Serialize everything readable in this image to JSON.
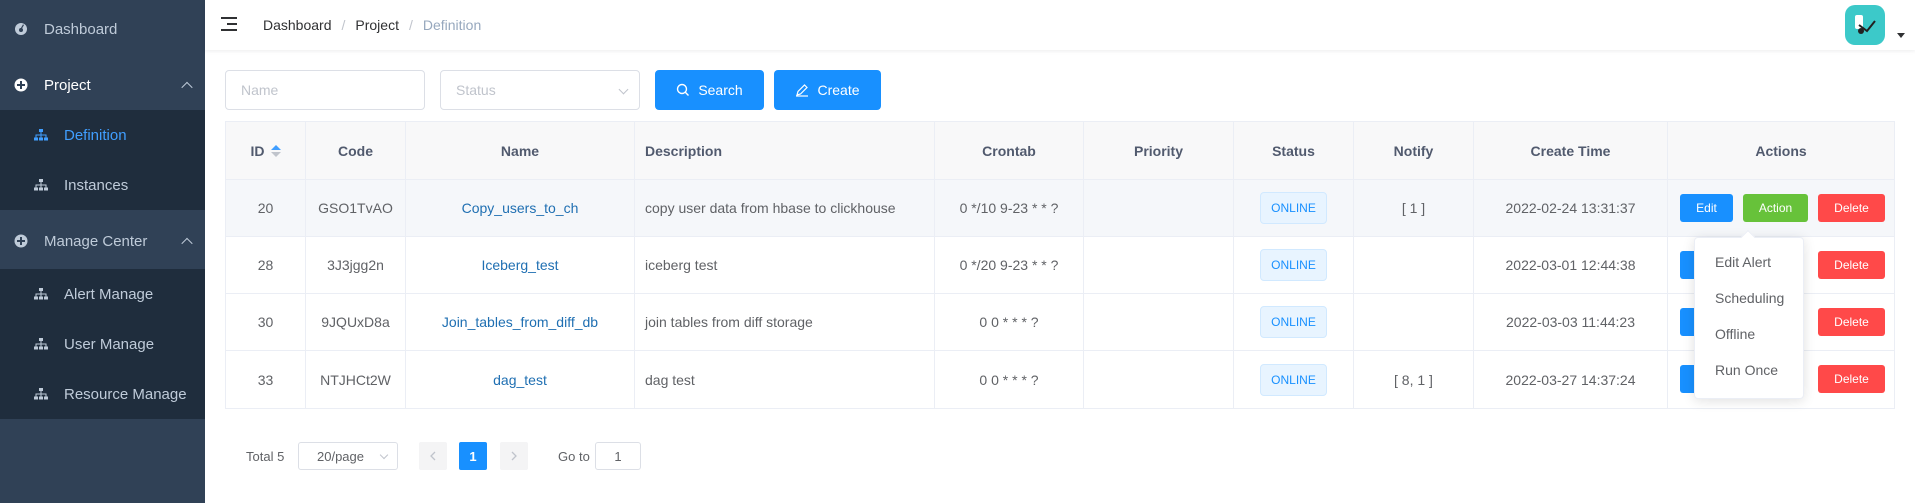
{
  "sidebar": {
    "items": [
      {
        "label": "Dashboard",
        "icon": "dashboard-icon"
      },
      {
        "label": "Project",
        "icon": "project-icon",
        "expanded": true
      },
      {
        "label": "Definition",
        "icon": "tree-icon",
        "active": true
      },
      {
        "label": "Instances",
        "icon": "tree-icon"
      },
      {
        "label": "Manage Center",
        "icon": "manage-icon",
        "expanded": true
      },
      {
        "label": "Alert Manage",
        "icon": "tree-icon"
      },
      {
        "label": "User Manage",
        "icon": "tree-icon"
      },
      {
        "label": "Resource Manage",
        "icon": "tree-icon"
      }
    ]
  },
  "breadcrumb": [
    "Dashboard",
    "Project",
    "Definition"
  ],
  "breadcrumb_sep": "/",
  "filters": {
    "name_placeholder": "Name",
    "status_placeholder": "Status",
    "search_label": "Search",
    "create_label": "Create"
  },
  "table": {
    "columns": [
      "ID",
      "Code",
      "Name",
      "Description",
      "Crontab",
      "Priority",
      "Status",
      "Notify",
      "Create Time",
      "Actions"
    ],
    "rows": [
      {
        "id": "20",
        "code": "GSO1TvAO",
        "name": "Copy_users_to_ch",
        "description": "copy user data from hbase to clickhouse",
        "crontab": "0 */10 9-23 * * ?",
        "priority": "",
        "status": "ONLINE",
        "notify": "[ 1 ]",
        "create_time": "2022-02-24 13:31:37"
      },
      {
        "id": "28",
        "code": "3J3jgg2n",
        "name": "Iceberg_test",
        "description": "iceberg test",
        "crontab": "0 */20 9-23 * * ?",
        "priority": "",
        "status": "ONLINE",
        "notify": "",
        "create_time": "2022-03-01 12:44:38"
      },
      {
        "id": "30",
        "code": "9JQUxD8a",
        "name": "Join_tables_from_diff_db",
        "description": "join tables from diff storage",
        "crontab": "0 0 * * * ?",
        "priority": "",
        "status": "ONLINE",
        "notify": "",
        "create_time": "2022-03-03 11:44:23"
      },
      {
        "id": "33",
        "code": "NTJHCt2W",
        "name": "dag_test",
        "description": "dag test",
        "crontab": "0 0 * * * ?",
        "priority": "",
        "status": "ONLINE",
        "notify": "[ 8, 1 ]",
        "create_time": "2022-03-27 14:37:24"
      }
    ],
    "actions": {
      "edit": "Edit",
      "action": "Action",
      "delete": "Delete"
    }
  },
  "action_menu": [
    "Edit Alert",
    "Scheduling",
    "Offline",
    "Run Once"
  ],
  "pagination": {
    "total_label": "Total 5",
    "page_size": "20/page",
    "current_page": "1",
    "goto_label": "Go to",
    "goto_value": "1"
  },
  "colors": {
    "sidebar_bg": "#304156",
    "submenu_bg": "#1f2d3d",
    "primary": "#1890ff",
    "success": "#67c23a",
    "danger": "#ff4949"
  }
}
